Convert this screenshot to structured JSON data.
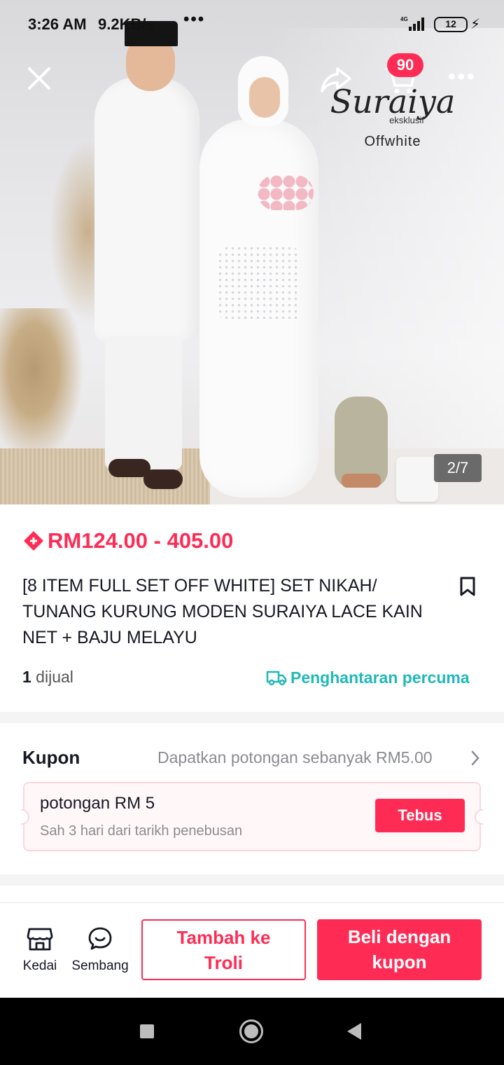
{
  "status_bar": {
    "time": "3:26 AM",
    "speed": "9.2KB/s",
    "overflow": "•••",
    "battery": "12",
    "network": "4G"
  },
  "hero": {
    "brand_name": "Suraiya",
    "brand_sub": "eksklusif",
    "variant_color": "Offwhite",
    "cart_badge": "90",
    "image_counter": "2/7",
    "icons": [
      "close-icon",
      "share-icon",
      "cart-icon",
      "more-icon"
    ]
  },
  "product": {
    "price": "RM124.00 - 405.00",
    "title": "[8 ITEM FULL SET OFF WHITE] SET NIKAH/ TUNANG KURUNG MODEN SURAIYA LACE KAIN NET + BAJU MELAYU",
    "sold_count": "1",
    "sold_label": " dijual",
    "shipping": "Penghantaran percuma"
  },
  "coupon": {
    "label": "Kupon",
    "description": "Dapatkan potongan sebanyak RM5.00",
    "title": "potongan RM 5",
    "validity": "Sah 3 hari dari tarikh penebusan",
    "redeem_label": "Tebus"
  },
  "bottom_bar": {
    "store_label": "Kedai",
    "chat_label": "Sembang",
    "add_cart_line1": "Tambah ke",
    "add_cart_line2": "Troli",
    "buy_line1": "Beli dengan",
    "buy_line2": "kupon"
  },
  "colors": {
    "accent": "#fe2c55",
    "shipping": "#20b9b7",
    "muted": "#8a8b91"
  }
}
